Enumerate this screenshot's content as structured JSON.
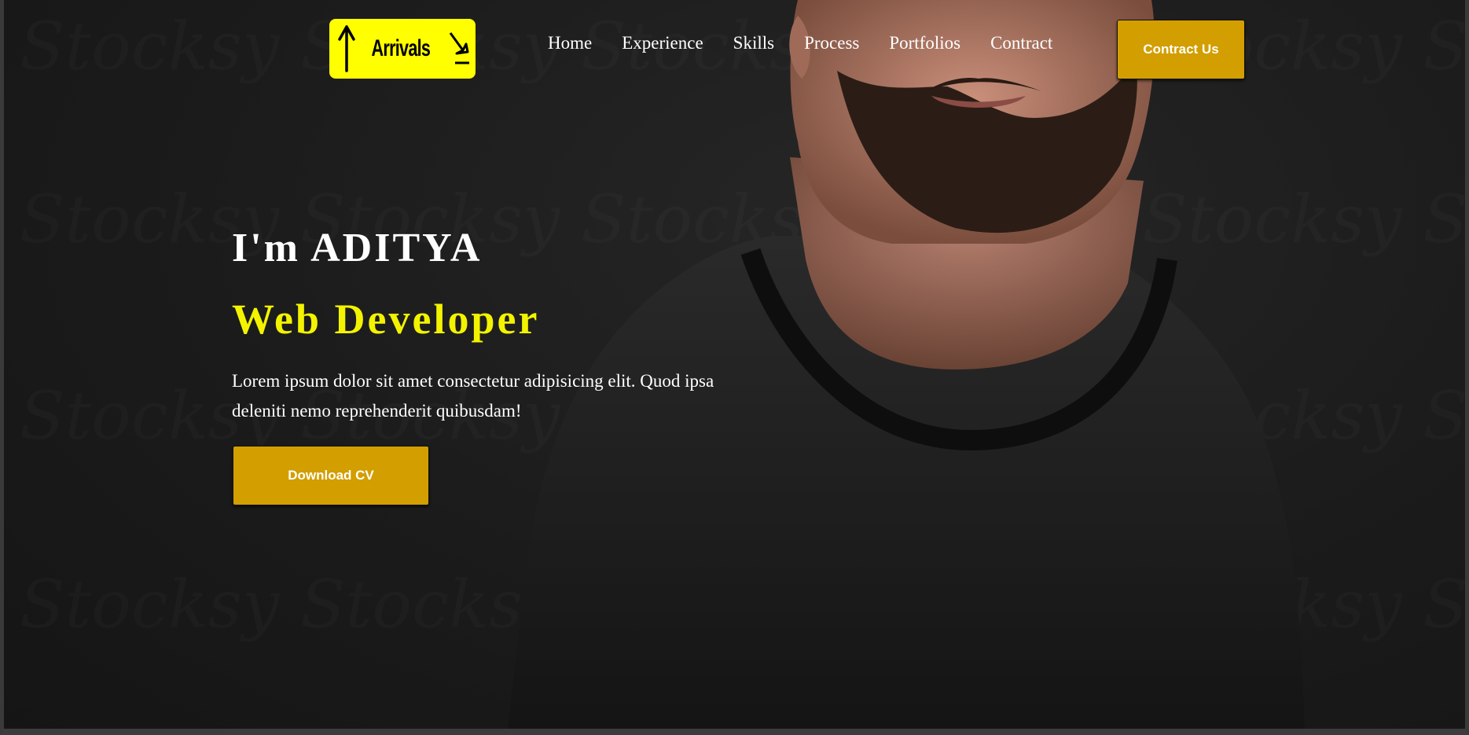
{
  "logo": {
    "text": "Arrivals",
    "background": "#ffff00"
  },
  "nav": {
    "items": [
      "Home",
      "Experience",
      "Skills",
      "Process",
      "Portfolios",
      "Contract"
    ]
  },
  "header": {
    "contact_button": "Contract Us"
  },
  "hero": {
    "name": "I'm ADITYA",
    "role": "Web Developer",
    "description": "Lorem ipsum dolor sit amet consectetur adipisicing elit. Quod ipsa deleniti nemo reprehenderit quibusdam!",
    "cv_button": "Download CV"
  },
  "colors": {
    "accent": "#d39e00",
    "role_text": "#f3f300",
    "background": "#1b1b1b"
  },
  "icons": [
    "arrow-up-icon",
    "plane-landing-icon"
  ]
}
